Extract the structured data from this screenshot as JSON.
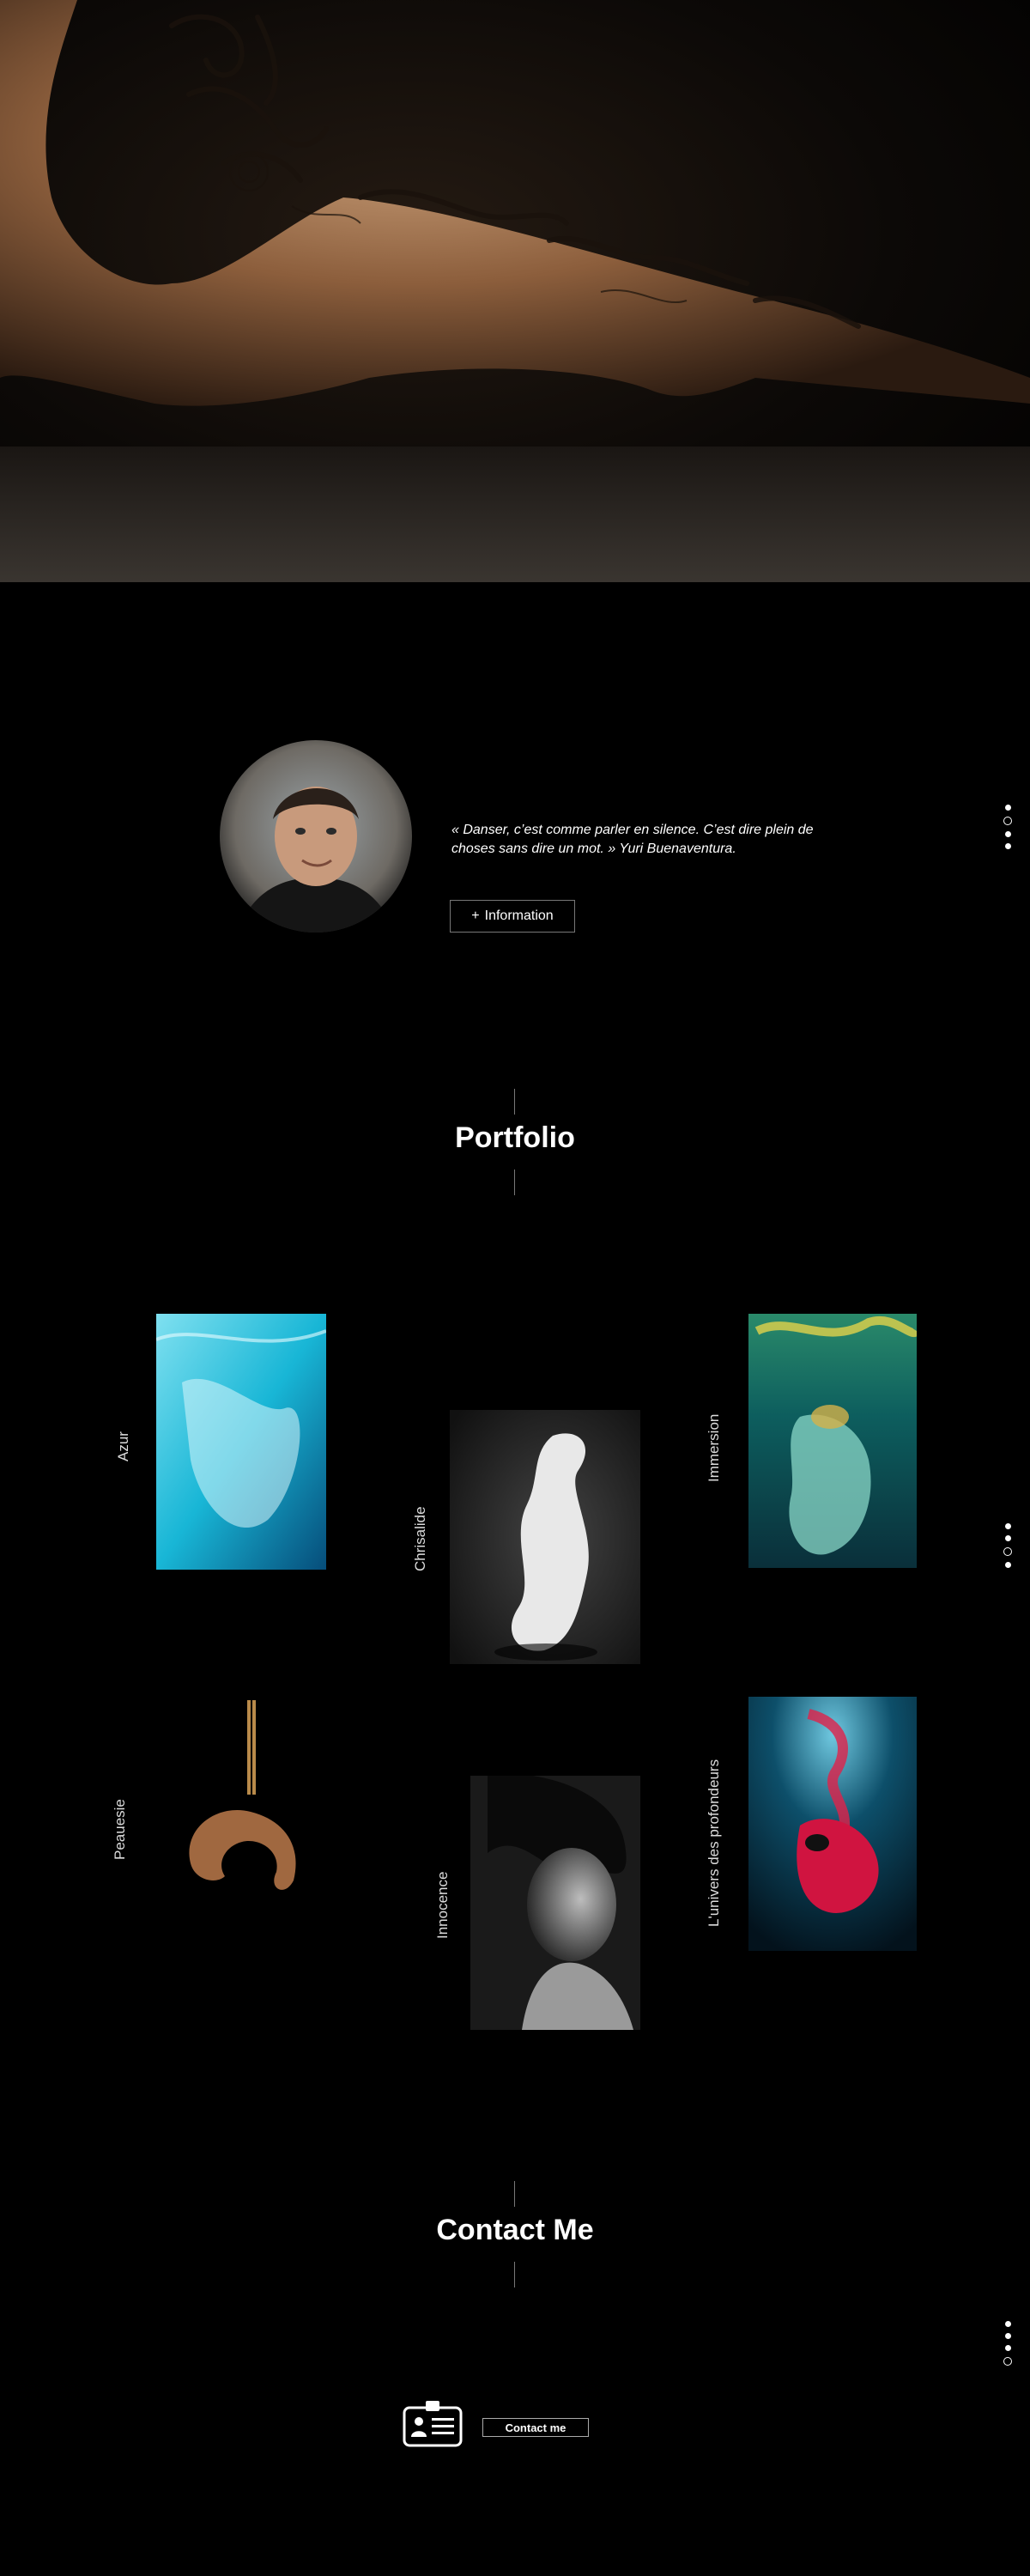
{
  "hero": {
    "image": "tattooed-dancer-photo"
  },
  "about": {
    "quote": "« Danser, c’est comme parler en silence. C’est dire plein de choses sans dire un mot. »",
    "author": "Yuri Buenaventura.",
    "button_icon": "+",
    "button_label": "Information"
  },
  "portfolio": {
    "title": "Portfolio",
    "items": [
      {
        "label": "Azur"
      },
      {
        "label": "Chrisalide"
      },
      {
        "label": "Immersion"
      },
      {
        "label": "Peauesie"
      },
      {
        "label": "Innocence"
      },
      {
        "label": "L'univers des profondeurs"
      }
    ]
  },
  "contact": {
    "title": "Contact Me",
    "button_label": "Contact me",
    "icon": "id-card-icon"
  },
  "colors": {
    "background": "#000000",
    "text": "#ffffff",
    "border": "#777777"
  }
}
